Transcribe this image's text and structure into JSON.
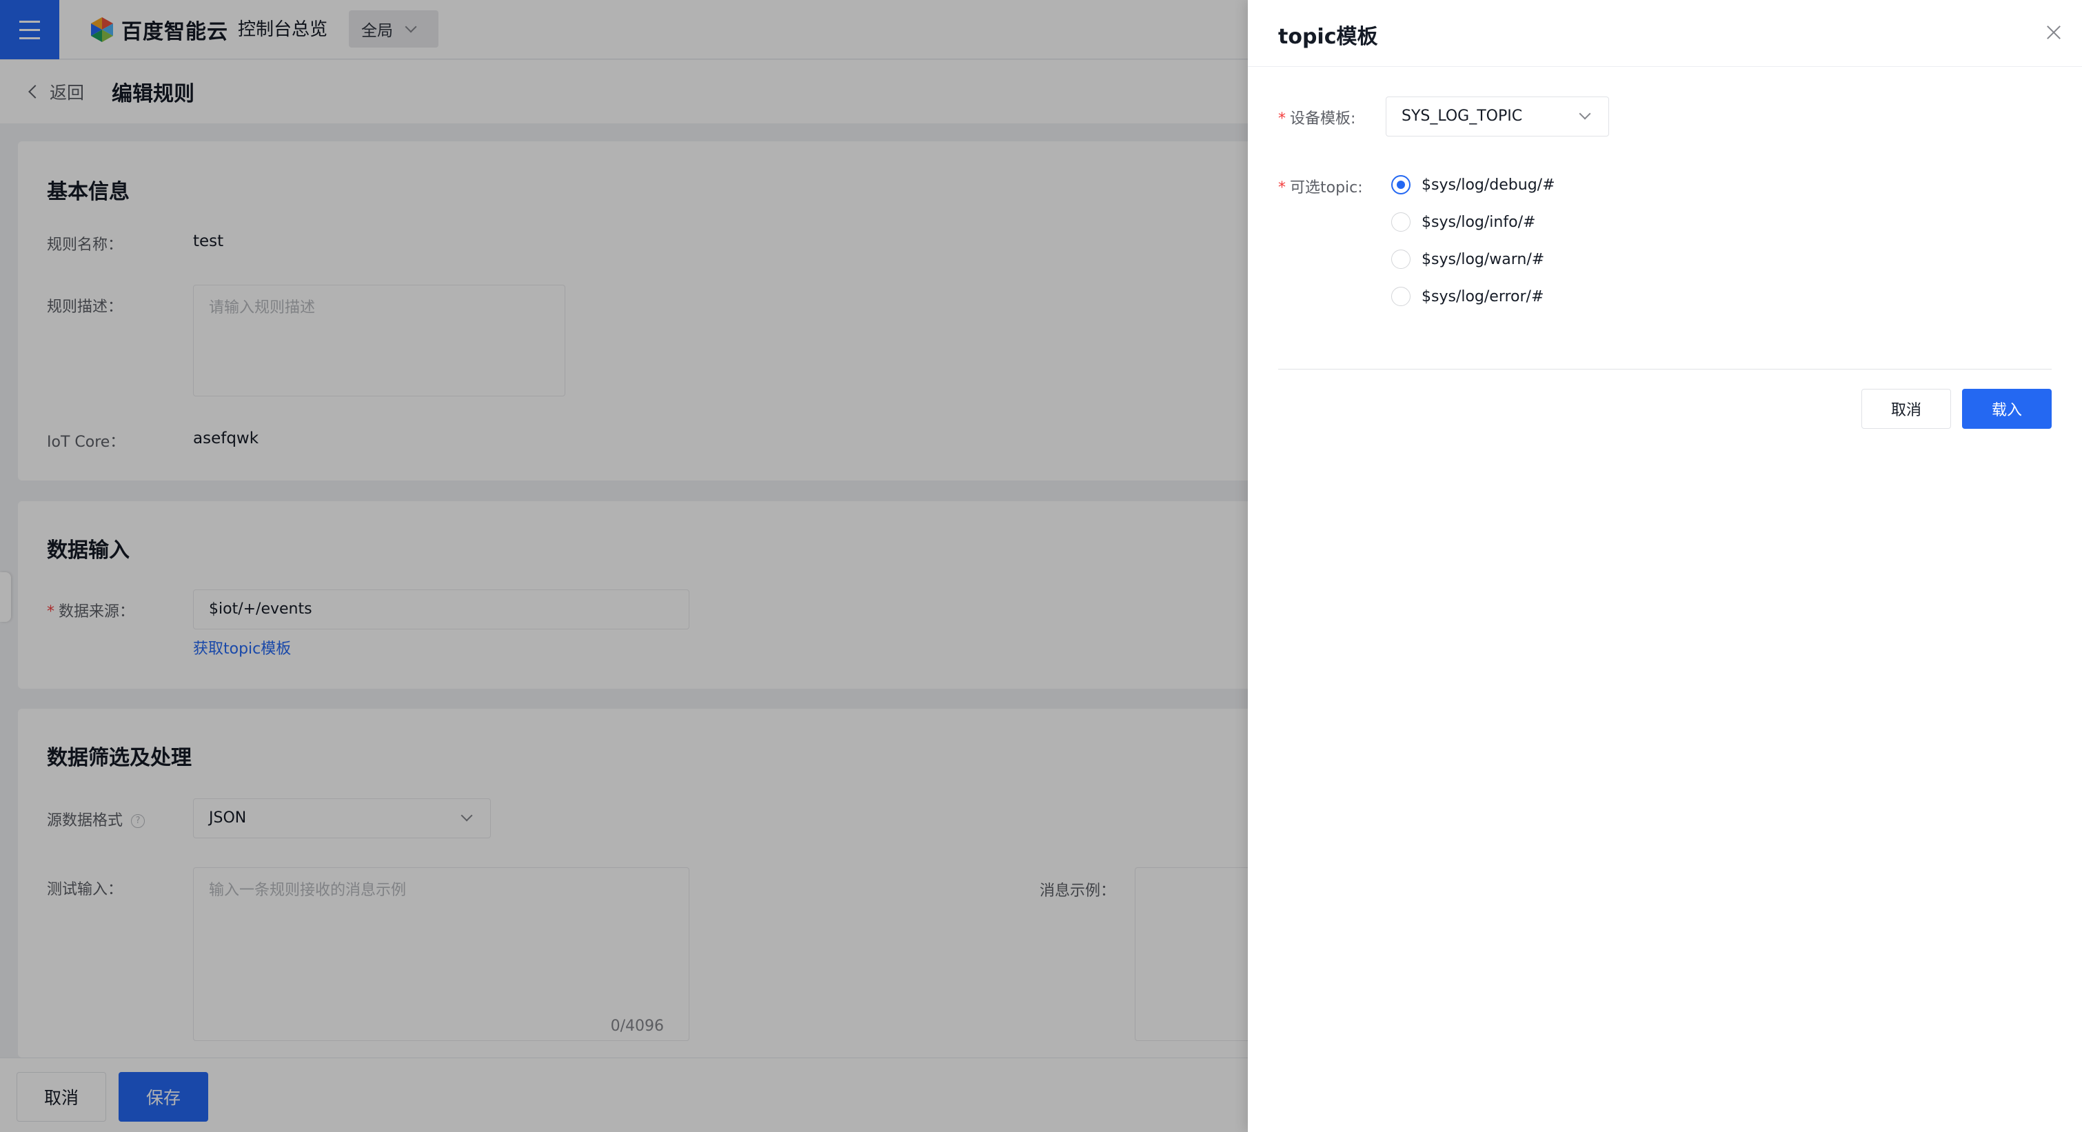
{
  "topbar": {
    "logo_text": "百度智能云",
    "console_link": "控制台总览",
    "region": "全局"
  },
  "subheader": {
    "back_label": "返回",
    "title": "编辑规则"
  },
  "basic_info": {
    "title": "基本信息",
    "name_label": "规则名称：",
    "name_value": "test",
    "desc_label": "规则描述：",
    "desc_placeholder": "请输入规则描述",
    "iot_label": "IoT Core：",
    "iot_value": "asefqwk"
  },
  "data_input": {
    "title": "数据输入",
    "source_label": "数据来源：",
    "source_value": "$iot/+/events",
    "template_link": "获取topic模板"
  },
  "data_filter": {
    "title": "数据筛选及处理",
    "format_label": "源数据格式",
    "format_value": "JSON",
    "test_input_label": "测试输入：",
    "test_input_placeholder": "输入一条规则接收的消息示例",
    "counter": "0/4096",
    "message_example_label": "消息示例："
  },
  "footer": {
    "cancel_label": "取消",
    "save_label": "保存"
  },
  "drawer": {
    "title": "topic模板",
    "device_template_label": "设备模板:",
    "device_template_value": "SYS_LOG_TOPIC",
    "topic_label": "可选topic:",
    "topics": [
      {
        "label": "$sys/log/debug/#",
        "checked": true
      },
      {
        "label": "$sys/log/info/#",
        "checked": false
      },
      {
        "label": "$sys/log/warn/#",
        "checked": false
      },
      {
        "label": "$sys/log/error/#",
        "checked": false
      }
    ],
    "cancel_label": "取消",
    "load_label": "载入"
  },
  "colors": {
    "primary": "#2468f2",
    "required": "#f33e3e"
  }
}
